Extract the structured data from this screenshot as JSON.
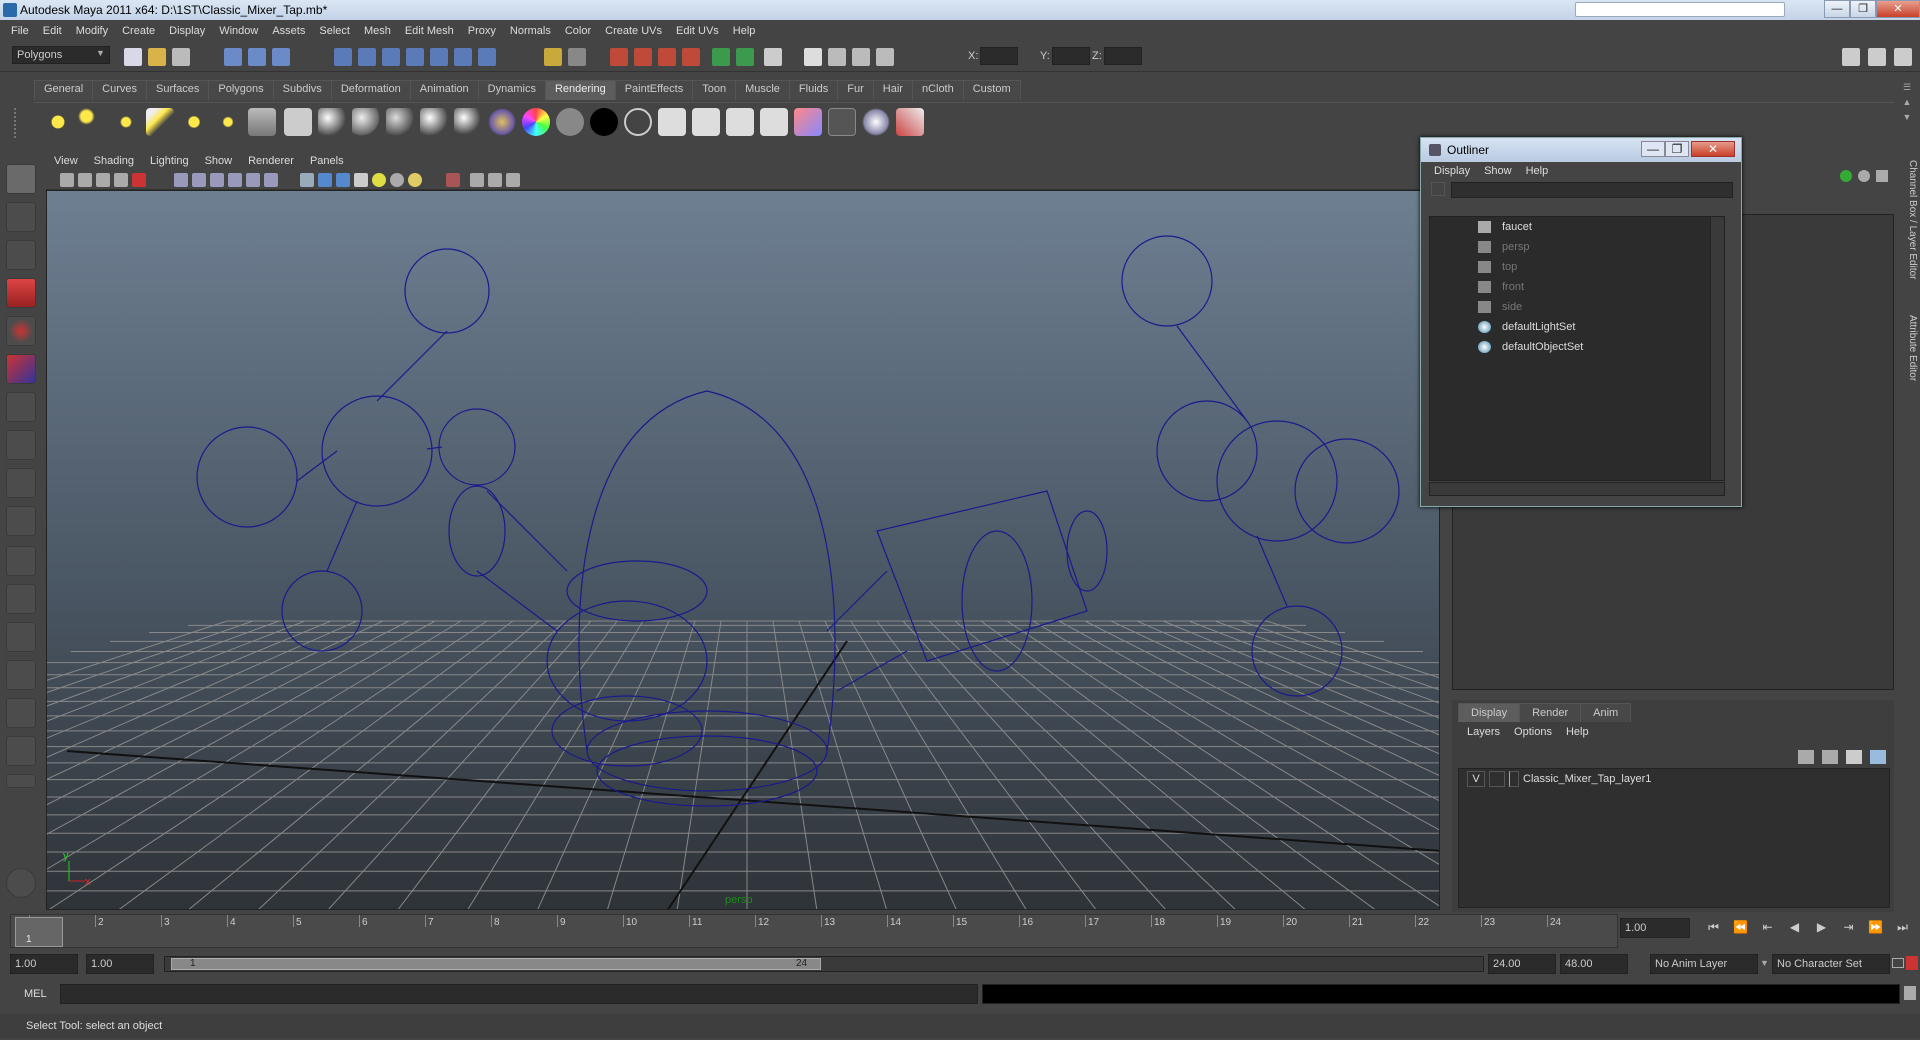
{
  "window": {
    "title": "Autodesk Maya 2011 x64: D:\\1ST\\Classic_Mixer_Tap.mb*",
    "controls": [
      "—",
      "❐",
      "✕"
    ]
  },
  "menu": [
    "File",
    "Edit",
    "Modify",
    "Create",
    "Display",
    "Window",
    "Assets",
    "Select",
    "Mesh",
    "Edit Mesh",
    "Proxy",
    "Normals",
    "Color",
    "Create UVs",
    "Edit UVs",
    "Help"
  ],
  "statusline": {
    "mode": "Polygons",
    "x_label": "X:",
    "y_label": "Y:",
    "z_label": "Z:"
  },
  "shelf_tabs": [
    "General",
    "Curves",
    "Surfaces",
    "Polygons",
    "Subdivs",
    "Deformation",
    "Animation",
    "Dynamics",
    "Rendering",
    "PaintEffects",
    "Toon",
    "Muscle",
    "Fluids",
    "Fur",
    "Hair",
    "nCloth",
    "Custom"
  ],
  "shelf_active": "Rendering",
  "panel_menu": [
    "View",
    "Shading",
    "Lighting",
    "Show",
    "Renderer",
    "Panels"
  ],
  "viewport": {
    "camera_label": "persp",
    "axis_y": "y",
    "axis_x": "x"
  },
  "outliner": {
    "title": "Outliner",
    "menu": [
      "Display",
      "Show",
      "Help"
    ],
    "items": [
      {
        "label": "faucet",
        "dim": false
      },
      {
        "label": "persp",
        "dim": true
      },
      {
        "label": "top",
        "dim": true
      },
      {
        "label": "front",
        "dim": true
      },
      {
        "label": "side",
        "dim": true
      },
      {
        "label": "defaultLightSet",
        "dim": false
      },
      {
        "label": "defaultObjectSet",
        "dim": false
      }
    ]
  },
  "side_tabs": {
    "channel_box": "Channel Box / Layer Editor",
    "attribute_editor": "Attribute Editor"
  },
  "layer_editor": {
    "tabs": [
      "Display",
      "Render",
      "Anim"
    ],
    "active_tab": "Display",
    "menu": [
      "Layers",
      "Options",
      "Help"
    ],
    "layers": [
      {
        "visible": "V",
        "name": "Classic_Mixer_Tap_layer1"
      }
    ]
  },
  "timeline": {
    "frames": [
      "1",
      "2",
      "3",
      "4",
      "5",
      "6",
      "7",
      "8",
      "9",
      "10",
      "11",
      "12",
      "13",
      "14",
      "15",
      "16",
      "17",
      "18",
      "19",
      "20",
      "21",
      "22",
      "23",
      "24"
    ],
    "current_frame": "1",
    "current_time_field": "1.00"
  },
  "range": {
    "start_time": "1.00",
    "playback_start": "1.00",
    "range_start_label": "1",
    "range_end_label": "24",
    "playback_end": "24.00",
    "end_time": "48.00",
    "anim_layer": "No Anim Layer",
    "character_set": "No Character Set"
  },
  "command_line": {
    "label": "MEL"
  },
  "help_line": "Select Tool: select an object",
  "colors": {
    "wire": "#1a1a8c",
    "grid": "#8a8a8a",
    "ui_bg": "#444444"
  }
}
